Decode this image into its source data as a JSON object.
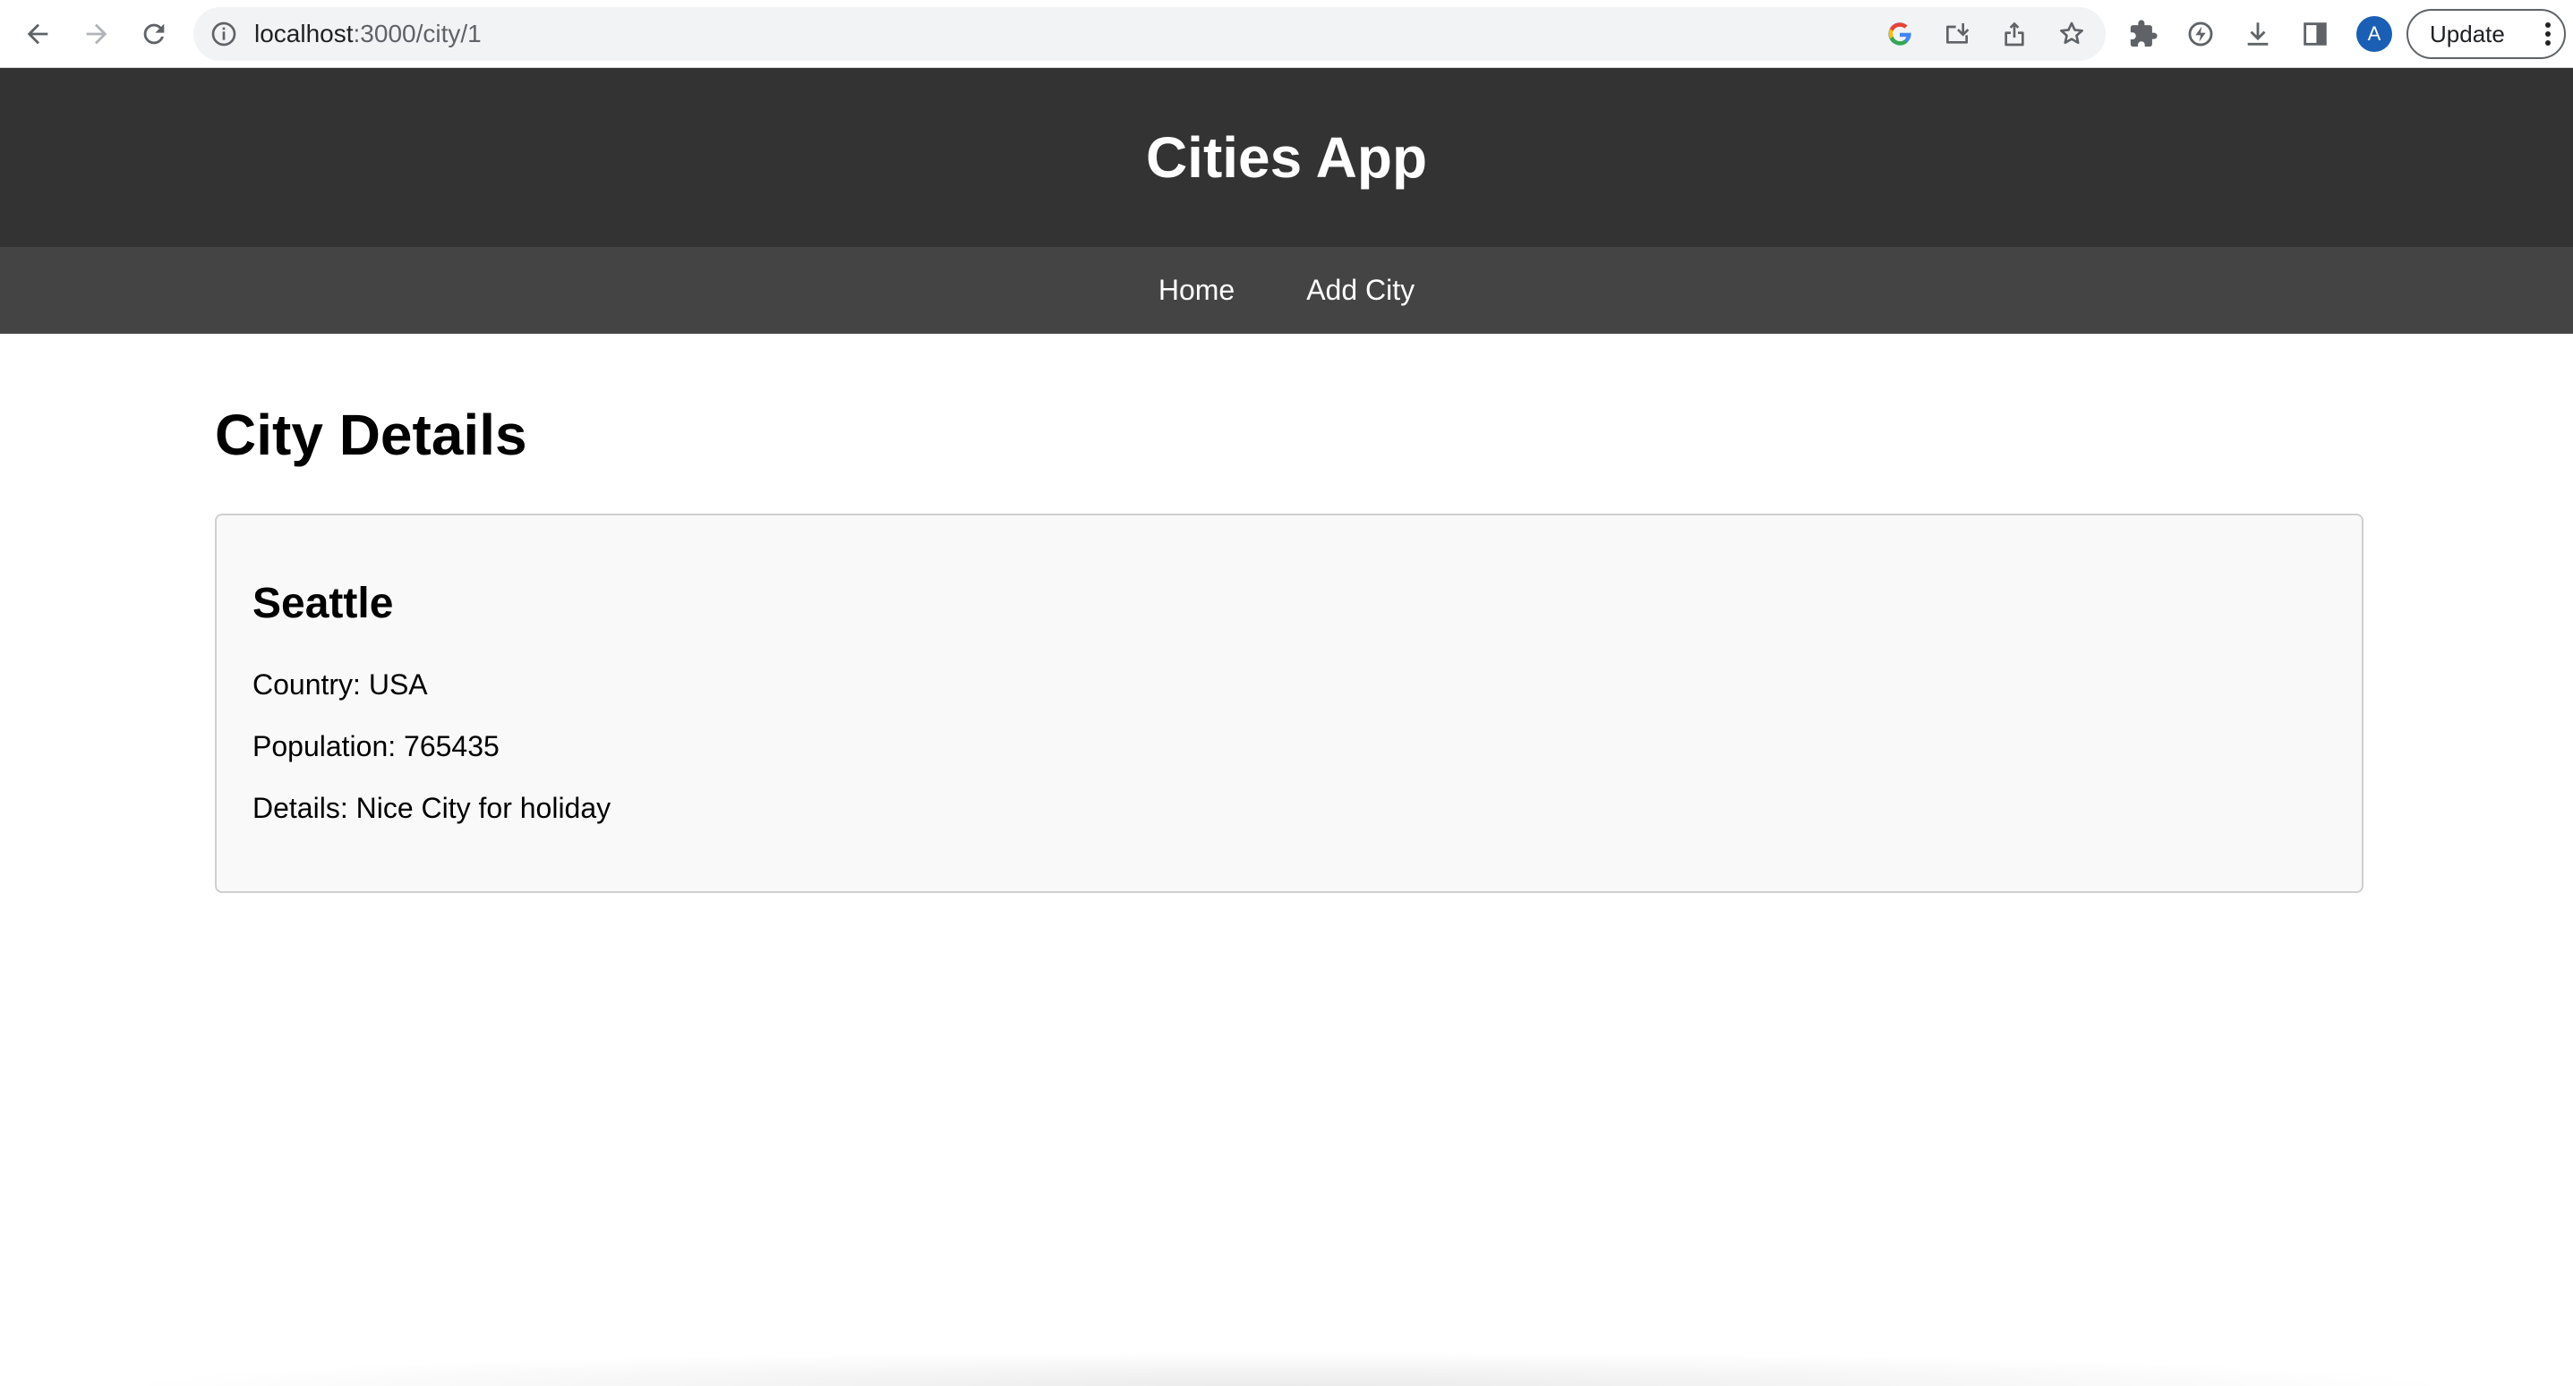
{
  "browser": {
    "url_host": "localhost",
    "url_path": ":3000/city/1",
    "update_label": "Update",
    "avatar_letter": "A",
    "icons": [
      "back-icon",
      "forward-icon",
      "reload-icon",
      "site-info-icon",
      "google-lens-icon",
      "install-app-icon",
      "share-icon",
      "bookmark-star-icon",
      "extensions-icon",
      "performance-icon",
      "download-icon",
      "side-panel-icon",
      "kebab-menu-icon"
    ]
  },
  "header": {
    "title": "Cities App"
  },
  "nav": {
    "items": [
      {
        "label": "Home"
      },
      {
        "label": "Add City"
      }
    ]
  },
  "main": {
    "heading": "City Details",
    "city": {
      "name": "Seattle",
      "country_line": "Country: USA",
      "population_line": "Population: 765435",
      "details_line": "Details: Nice City for holiday"
    }
  },
  "colors": {
    "header_bg": "#333333",
    "nav_bg": "#444444",
    "card_bg": "#f9f9f9",
    "card_border": "#cfcfcf"
  }
}
